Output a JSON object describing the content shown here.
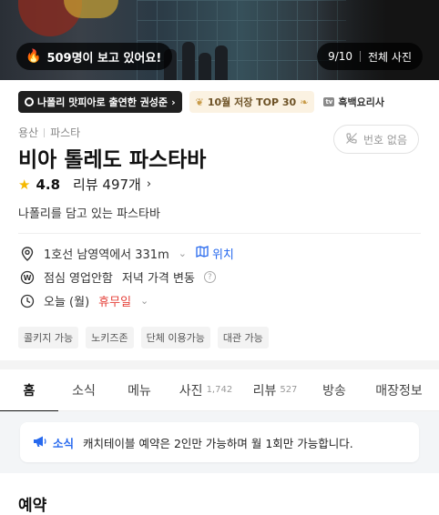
{
  "hero": {
    "viewers_text": "509명이 보고 있어요!",
    "photo_index": "9/10",
    "all_photos": "전체 사진"
  },
  "tags": [
    {
      "text": "나폴리 맛피아로 출연한 권성준",
      "icon": "ring-icon",
      "style": "dark"
    },
    {
      "text": "10월 저장 TOP 30",
      "icon": "laurel-icon",
      "style": "gold"
    },
    {
      "text": "흑백요리사",
      "icon": "tv-icon",
      "style": "tv",
      "icon_text": "tv"
    }
  ],
  "place": {
    "region": "용산",
    "category": "파스타",
    "name": "비아 톨레도 파스타바",
    "rating": "4.8",
    "review_label": "리뷰 497개",
    "description": "나폴리를 담고 있는 파스타바",
    "phone_button": "번호 없음"
  },
  "info": {
    "location": "1호선 남영역에서 331m",
    "map_link": "위치",
    "lunch": "점심 영업안함",
    "dinner": "저녁 가격 변동",
    "today": "오늘 (월)",
    "holiday": "휴무일"
  },
  "chips": [
    "콜키지 가능",
    "노키즈존",
    "단체 이용가능",
    "대관 가능"
  ],
  "tabs": [
    {
      "label": "홈",
      "count": ""
    },
    {
      "label": "소식",
      "count": ""
    },
    {
      "label": "메뉴",
      "count": ""
    },
    {
      "label": "사진",
      "count": "1,742"
    },
    {
      "label": "리뷰",
      "count": "527"
    },
    {
      "label": "방송",
      "count": ""
    },
    {
      "label": "매장정보",
      "count": ""
    }
  ],
  "active_tab": "홈",
  "notice": {
    "label": "소식",
    "text": "캐치테이블 예약은 2인만 가능하며 월 1회만 가능합니다."
  },
  "section": {
    "title": "예약"
  },
  "colors": {
    "accent": "#2769ee",
    "holiday": "#e5413a",
    "star": "#f5b800"
  }
}
